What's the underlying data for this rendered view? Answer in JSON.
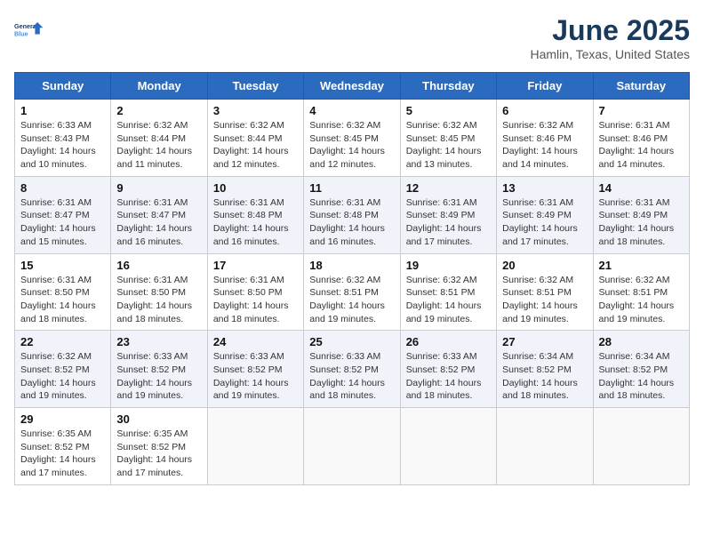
{
  "header": {
    "logo_line1": "General",
    "logo_line2": "Blue",
    "month_title": "June 2025",
    "location": "Hamlin, Texas, United States"
  },
  "calendar": {
    "days_of_week": [
      "Sunday",
      "Monday",
      "Tuesday",
      "Wednesday",
      "Thursday",
      "Friday",
      "Saturday"
    ],
    "weeks": [
      [
        {
          "day": "1",
          "sunrise": "6:33 AM",
          "sunset": "8:43 PM",
          "daylight": "14 hours and 10 minutes."
        },
        {
          "day": "2",
          "sunrise": "6:32 AM",
          "sunset": "8:44 PM",
          "daylight": "14 hours and 11 minutes."
        },
        {
          "day": "3",
          "sunrise": "6:32 AM",
          "sunset": "8:44 PM",
          "daylight": "14 hours and 12 minutes."
        },
        {
          "day": "4",
          "sunrise": "6:32 AM",
          "sunset": "8:45 PM",
          "daylight": "14 hours and 12 minutes."
        },
        {
          "day": "5",
          "sunrise": "6:32 AM",
          "sunset": "8:45 PM",
          "daylight": "14 hours and 13 minutes."
        },
        {
          "day": "6",
          "sunrise": "6:32 AM",
          "sunset": "8:46 PM",
          "daylight": "14 hours and 14 minutes."
        },
        {
          "day": "7",
          "sunrise": "6:31 AM",
          "sunset": "8:46 PM",
          "daylight": "14 hours and 14 minutes."
        }
      ],
      [
        {
          "day": "8",
          "sunrise": "6:31 AM",
          "sunset": "8:47 PM",
          "daylight": "14 hours and 15 minutes."
        },
        {
          "day": "9",
          "sunrise": "6:31 AM",
          "sunset": "8:47 PM",
          "daylight": "14 hours and 16 minutes."
        },
        {
          "day": "10",
          "sunrise": "6:31 AM",
          "sunset": "8:48 PM",
          "daylight": "14 hours and 16 minutes."
        },
        {
          "day": "11",
          "sunrise": "6:31 AM",
          "sunset": "8:48 PM",
          "daylight": "14 hours and 16 minutes."
        },
        {
          "day": "12",
          "sunrise": "6:31 AM",
          "sunset": "8:49 PM",
          "daylight": "14 hours and 17 minutes."
        },
        {
          "day": "13",
          "sunrise": "6:31 AM",
          "sunset": "8:49 PM",
          "daylight": "14 hours and 17 minutes."
        },
        {
          "day": "14",
          "sunrise": "6:31 AM",
          "sunset": "8:49 PM",
          "daylight": "14 hours and 18 minutes."
        }
      ],
      [
        {
          "day": "15",
          "sunrise": "6:31 AM",
          "sunset": "8:50 PM",
          "daylight": "14 hours and 18 minutes."
        },
        {
          "day": "16",
          "sunrise": "6:31 AM",
          "sunset": "8:50 PM",
          "daylight": "14 hours and 18 minutes."
        },
        {
          "day": "17",
          "sunrise": "6:31 AM",
          "sunset": "8:50 PM",
          "daylight": "14 hours and 18 minutes."
        },
        {
          "day": "18",
          "sunrise": "6:32 AM",
          "sunset": "8:51 PM",
          "daylight": "14 hours and 19 minutes."
        },
        {
          "day": "19",
          "sunrise": "6:32 AM",
          "sunset": "8:51 PM",
          "daylight": "14 hours and 19 minutes."
        },
        {
          "day": "20",
          "sunrise": "6:32 AM",
          "sunset": "8:51 PM",
          "daylight": "14 hours and 19 minutes."
        },
        {
          "day": "21",
          "sunrise": "6:32 AM",
          "sunset": "8:51 PM",
          "daylight": "14 hours and 19 minutes."
        }
      ],
      [
        {
          "day": "22",
          "sunrise": "6:32 AM",
          "sunset": "8:52 PM",
          "daylight": "14 hours and 19 minutes."
        },
        {
          "day": "23",
          "sunrise": "6:33 AM",
          "sunset": "8:52 PM",
          "daylight": "14 hours and 19 minutes."
        },
        {
          "day": "24",
          "sunrise": "6:33 AM",
          "sunset": "8:52 PM",
          "daylight": "14 hours and 19 minutes."
        },
        {
          "day": "25",
          "sunrise": "6:33 AM",
          "sunset": "8:52 PM",
          "daylight": "14 hours and 18 minutes."
        },
        {
          "day": "26",
          "sunrise": "6:33 AM",
          "sunset": "8:52 PM",
          "daylight": "14 hours and 18 minutes."
        },
        {
          "day": "27",
          "sunrise": "6:34 AM",
          "sunset": "8:52 PM",
          "daylight": "14 hours and 18 minutes."
        },
        {
          "day": "28",
          "sunrise": "6:34 AM",
          "sunset": "8:52 PM",
          "daylight": "14 hours and 18 minutes."
        }
      ],
      [
        {
          "day": "29",
          "sunrise": "6:35 AM",
          "sunset": "8:52 PM",
          "daylight": "14 hours and 17 minutes."
        },
        {
          "day": "30",
          "sunrise": "6:35 AM",
          "sunset": "8:52 PM",
          "daylight": "14 hours and 17 minutes."
        },
        null,
        null,
        null,
        null,
        null
      ]
    ]
  },
  "labels": {
    "sunrise_prefix": "Sunrise: ",
    "sunset_prefix": "Sunset: ",
    "daylight_prefix": "Daylight: "
  }
}
